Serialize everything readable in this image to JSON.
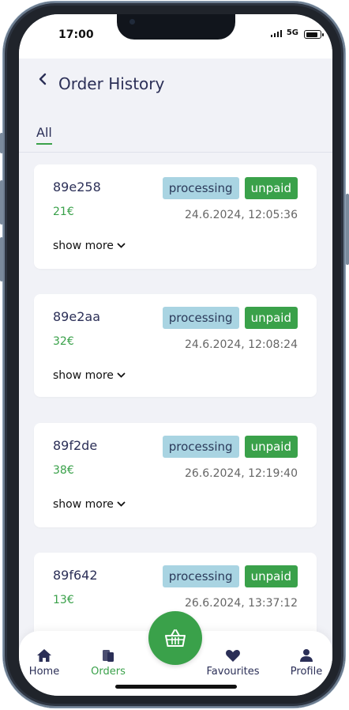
{
  "status": {
    "time": "17:00",
    "network": "5G"
  },
  "header": {
    "title": "Order History"
  },
  "tabs": [
    {
      "label": "All"
    }
  ],
  "orders": [
    {
      "id": "89e258",
      "price": "21€",
      "status": "processing",
      "payment": "unpaid",
      "date": "24.6.2024, 12:05:36",
      "more": "show more"
    },
    {
      "id": "89e2aa",
      "price": "32€",
      "status": "processing",
      "payment": "unpaid",
      "date": "24.6.2024, 12:08:24",
      "more": "show more"
    },
    {
      "id": "89f2de",
      "price": "38€",
      "status": "processing",
      "payment": "unpaid",
      "date": "26.6.2024, 12:19:40",
      "more": "show more"
    },
    {
      "id": "89f642",
      "price": "13€",
      "status": "processing",
      "payment": "unpaid",
      "date": "26.6.2024, 13:37:12"
    }
  ],
  "nav": {
    "home": "Home",
    "orders": "Orders",
    "favourites": "Favourites",
    "profile": "Profile"
  },
  "colors": {
    "accent": "#3aa14a",
    "badge_processing": "#a9d4e2",
    "title": "#2b2f57",
    "background": "#f1f2f7"
  },
  "icons": {
    "back": "chevron-left-icon",
    "more": "chevron-down-icon",
    "basket": "basket-icon"
  }
}
